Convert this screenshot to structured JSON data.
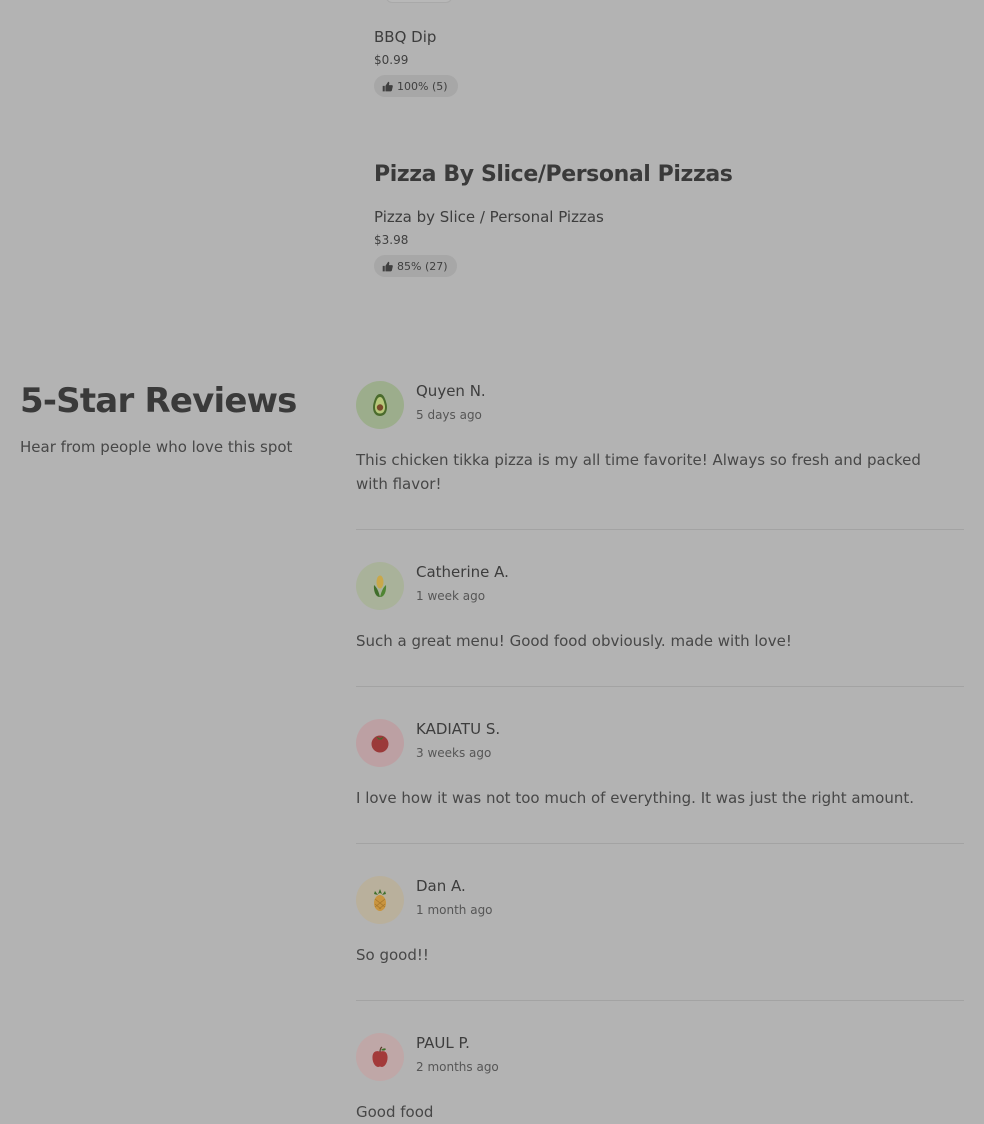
{
  "menu": {
    "items": [
      {
        "name": "BBQ Dip",
        "price": "$0.99",
        "rating": "100% (5)"
      },
      {
        "name": "Pizza by Slice / Personal Pizzas",
        "price": "$3.98",
        "rating": "85% (27)"
      }
    ],
    "categories": [
      {
        "title": "Pizza By Slice/Personal Pizzas"
      }
    ]
  },
  "reviews_section": {
    "heading": "5-Star Reviews",
    "subheading": "Hear from people who love this spot",
    "reviews": [
      {
        "name": "Quyen N.",
        "date": "5 days ago",
        "text": "This chicken tikka pizza is my all time favorite! Always so fresh and packed with flavor!",
        "avatar_icon": "avocado-icon",
        "avatar_color": "#9cad8c"
      },
      {
        "name": "Catherine A.",
        "date": "1 week ago",
        "text": "Such a great menu! Good food obviously. made with love!",
        "avatar_icon": "corn-icon",
        "avatar_color": "#a9b29a"
      },
      {
        "name": "KADIATU S.",
        "date": "3 weeks ago",
        "text": "I love how it was not too much of everything. It was just the right amount.",
        "avatar_icon": "tomato-icon",
        "avatar_color": "#bca0a3"
      },
      {
        "name": "Dan A.",
        "date": "1 month ago",
        "text": "So good!!",
        "avatar_icon": "pineapple-icon",
        "avatar_color": "#b9b09c"
      },
      {
        "name": "PAUL P.",
        "date": "2 months ago",
        "text": "Good food",
        "avatar_icon": "apple-icon",
        "avatar_color": "#bfa7a7"
      }
    ]
  },
  "icons": {
    "rating_icon": "thumbs-up-icon"
  }
}
